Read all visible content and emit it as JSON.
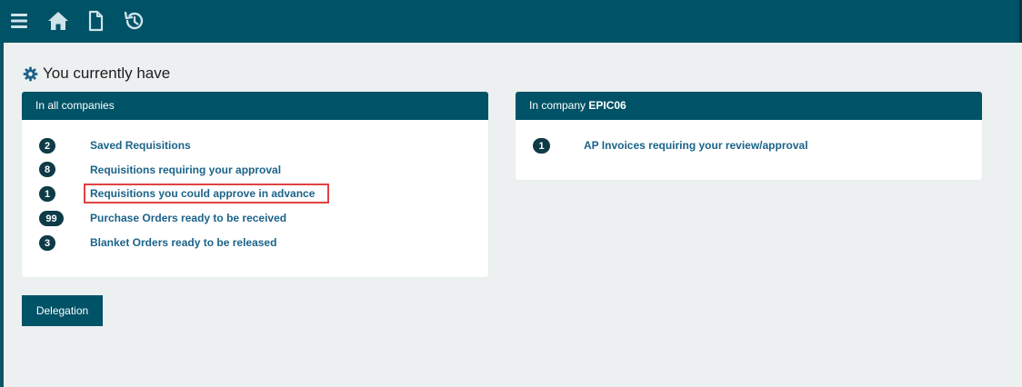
{
  "header": {
    "menu_icon": "hamburger-menu-icon",
    "home_icon": "home-icon",
    "document_icon": "document-icon",
    "history_icon": "history-icon"
  },
  "heading": {
    "icon": "gear-icon",
    "title": "You currently have"
  },
  "panel_all": {
    "header": "In all companies",
    "items": [
      {
        "count": "2",
        "label": "Saved Requisitions"
      },
      {
        "count": "8",
        "label": "Requisitions requiring your approval"
      },
      {
        "count": "1",
        "label": "Requisitions you could approve in advance"
      },
      {
        "count": "99",
        "label": "Purchase Orders ready to be received"
      },
      {
        "count": "3",
        "label": "Blanket Orders ready to be released"
      }
    ]
  },
  "panel_company": {
    "header_prefix": "In company ",
    "company": "EPIC06",
    "items": [
      {
        "count": "1",
        "label": "AP Invoices requiring your review/approval"
      }
    ]
  },
  "delegation_label": "Delegation",
  "colors": {
    "brand": "#005266",
    "badge": "#0e3b47",
    "link": "#1b6389",
    "highlight": "#e04141",
    "background": "#ecf0f1"
  }
}
